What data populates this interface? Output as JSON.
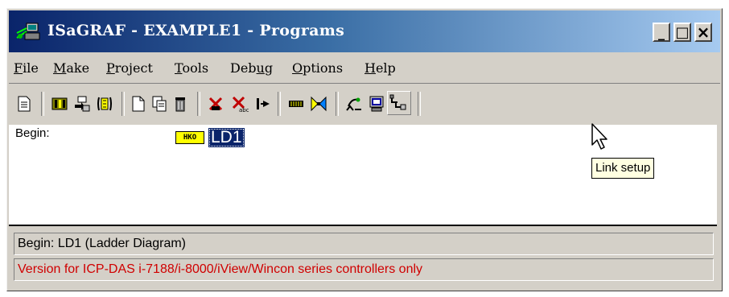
{
  "window": {
    "title": "ISaGRAF - EXAMPLE1 - Programs",
    "buttons": {
      "minimize": "_",
      "maximize": "□",
      "close": "×"
    }
  },
  "menu": [
    {
      "underline": "F",
      "rest": "ile"
    },
    {
      "underline": "M",
      "rest": "ake"
    },
    {
      "underline": "P",
      "rest": "roject"
    },
    {
      "underline": "T",
      "rest": "ools"
    },
    {
      "pre": "Deb",
      "underline": "u",
      "rest": "g"
    },
    {
      "underline": "O",
      "rest": "ptions"
    },
    {
      "underline": "H",
      "rest": "elp"
    }
  ],
  "toolbar": {
    "icons": [
      "edit-properties-icon",
      "dictionary-icon",
      "io-connection-icon",
      "io-list-icon",
      "new-program-icon",
      "copy-program-icon",
      "delete-program-icon",
      "disable-icon",
      "verify-icon",
      "step-icon",
      "compile-icon",
      "simulate-icon",
      "debug-icon",
      "target-icon",
      "link-setup-icon"
    ]
  },
  "content": {
    "section_label": "Begin:",
    "program_icon_text": "HKO",
    "program_name": "LD1"
  },
  "tooltip": "Link setup",
  "status": {
    "line1": "Begin:  LD1   (Ladder Diagram)",
    "line2": "Version for ICP-DAS i-7188/i-8000/iView/Wincon series controllers only",
    "line2_color": "#d00000"
  },
  "colors": {
    "title_bar": "#0a246a",
    "selection": "#0a246a",
    "tooltip_bg": "#ffffe1"
  }
}
